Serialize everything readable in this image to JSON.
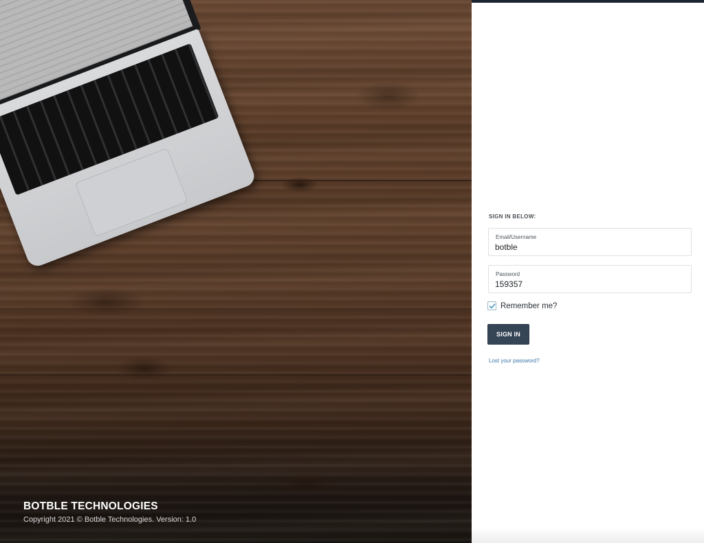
{
  "left_panel": {
    "brand_title": "BOTBLE TECHNOLOGIES",
    "copyright": "Copyright 2021 © Botble Technologies. Version: 1.0"
  },
  "login": {
    "heading": "SIGN IN BELOW:",
    "email_label": "Email/Username",
    "email_value": "botble",
    "password_label": "Password",
    "password_value": "159357",
    "remember_label": "Remember me?",
    "remember_checked": true,
    "signin_button": "SIGN IN",
    "lost_password_link": "Lost your password?"
  },
  "colors": {
    "top_bar": "#1c2430",
    "button_bg": "#364556",
    "link": "#3b77a8"
  },
  "icons": {
    "remember_checkbox": "check-icon"
  }
}
